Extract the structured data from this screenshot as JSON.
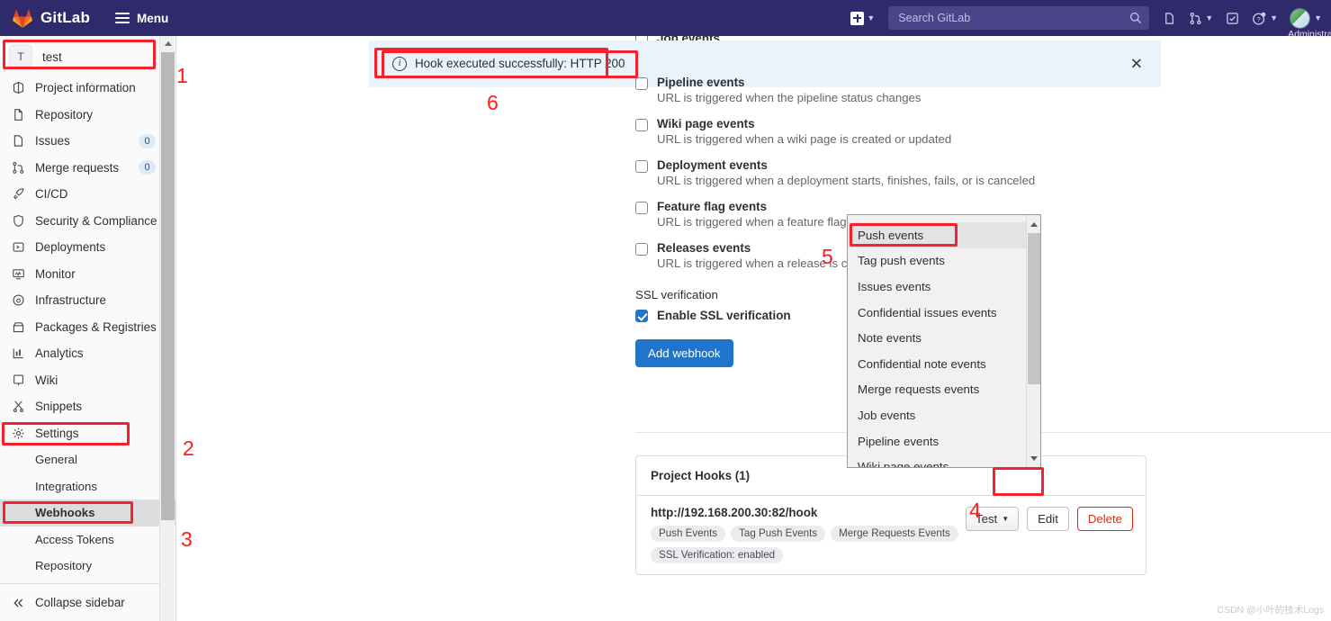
{
  "topnav": {
    "brand": "GitLab",
    "menu_label": "Menu",
    "search_placeholder": "Search GitLab",
    "user_label": "Administra",
    "icons": {
      "plus": "plus-square-icon",
      "issues": "issues-icon",
      "merge_requests": "merge-request-icon",
      "todos": "todo-check-icon",
      "help": "help-question-icon",
      "search": "search-icon"
    },
    "brand_color": "#2f2a6b"
  },
  "sidebar": {
    "project": {
      "initial": "T",
      "name": "test"
    },
    "items": [
      {
        "label": "Project information",
        "icon": "project-info-icon",
        "badge": null
      },
      {
        "label": "Repository",
        "icon": "repository-icon",
        "badge": null
      },
      {
        "label": "Issues",
        "icon": "issues-icon",
        "badge": "0"
      },
      {
        "label": "Merge requests",
        "icon": "merge-request-icon",
        "badge": "0"
      },
      {
        "label": "CI/CD",
        "icon": "rocket-icon",
        "badge": null
      },
      {
        "label": "Security & Compliance",
        "icon": "shield-icon",
        "badge": null
      },
      {
        "label": "Deployments",
        "icon": "deployments-icon",
        "badge": null
      },
      {
        "label": "Monitor",
        "icon": "monitor-icon",
        "badge": null
      },
      {
        "label": "Infrastructure",
        "icon": "infrastructure-icon",
        "badge": null
      },
      {
        "label": "Packages & Registries",
        "icon": "package-icon",
        "badge": null
      },
      {
        "label": "Analytics",
        "icon": "analytics-icon",
        "badge": null
      },
      {
        "label": "Wiki",
        "icon": "wiki-book-icon",
        "badge": null
      },
      {
        "label": "Snippets",
        "icon": "snippet-scissors-icon",
        "badge": null
      },
      {
        "label": "Settings",
        "icon": "gear-icon",
        "badge": null
      }
    ],
    "settings_subitems": [
      {
        "label": "General",
        "active": false
      },
      {
        "label": "Integrations",
        "active": false
      },
      {
        "label": "Webhooks",
        "active": true
      },
      {
        "label": "Access Tokens",
        "active": false
      },
      {
        "label": "Repository",
        "active": false
      }
    ],
    "collapse_label": "Collapse sidebar"
  },
  "alert": {
    "message": "Hook executed successfully: HTTP 200",
    "icon": "info-circle-icon",
    "close_icon": "close-icon",
    "bg_color": "#e9f3fc"
  },
  "events": {
    "clipped_top_label": "Job events",
    "list": [
      {
        "title": "Pipeline events",
        "desc": "URL is triggered when the pipeline status changes",
        "checked": false
      },
      {
        "title": "Wiki page events",
        "desc": "URL is triggered when a wiki page is created or updated",
        "checked": false
      },
      {
        "title": "Deployment events",
        "desc": "URL is triggered when a deployment starts, finishes, fails, or is canceled",
        "checked": false
      },
      {
        "title": "Feature flag events",
        "desc": "URL is triggered when a feature flag is",
        "checked": false
      },
      {
        "title": "Releases events",
        "desc": "URL is triggered when a release is crea",
        "checked": false
      }
    ],
    "ssl_section_label": "SSL verification",
    "ssl_checkbox_label": "Enable SSL verification",
    "ssl_checked": true,
    "add_button": "Add webhook"
  },
  "dropdown": {
    "selected": "Push events",
    "items": [
      "Push events",
      "Tag push events",
      "Issues events",
      "Confidential issues events",
      "Note events",
      "Confidential note events",
      "Merge requests events",
      "Job events",
      "Pipeline events",
      "Wiki page events"
    ]
  },
  "hooks": {
    "header": "Project Hooks (1)",
    "rows": [
      {
        "url": "http://192.168.200.30:82/hook",
        "pills": [
          "Push Events",
          "Tag Push Events",
          "Merge Requests Events",
          "SSL Verification: enabled"
        ],
        "test_button": "Test",
        "edit_button": "Edit",
        "delete_button": "Delete"
      }
    ]
  },
  "annotations": {
    "numbers": [
      "1",
      "2",
      "3",
      "4",
      "5",
      "6"
    ]
  },
  "watermark": "CSDN @小叶的技术Logs"
}
